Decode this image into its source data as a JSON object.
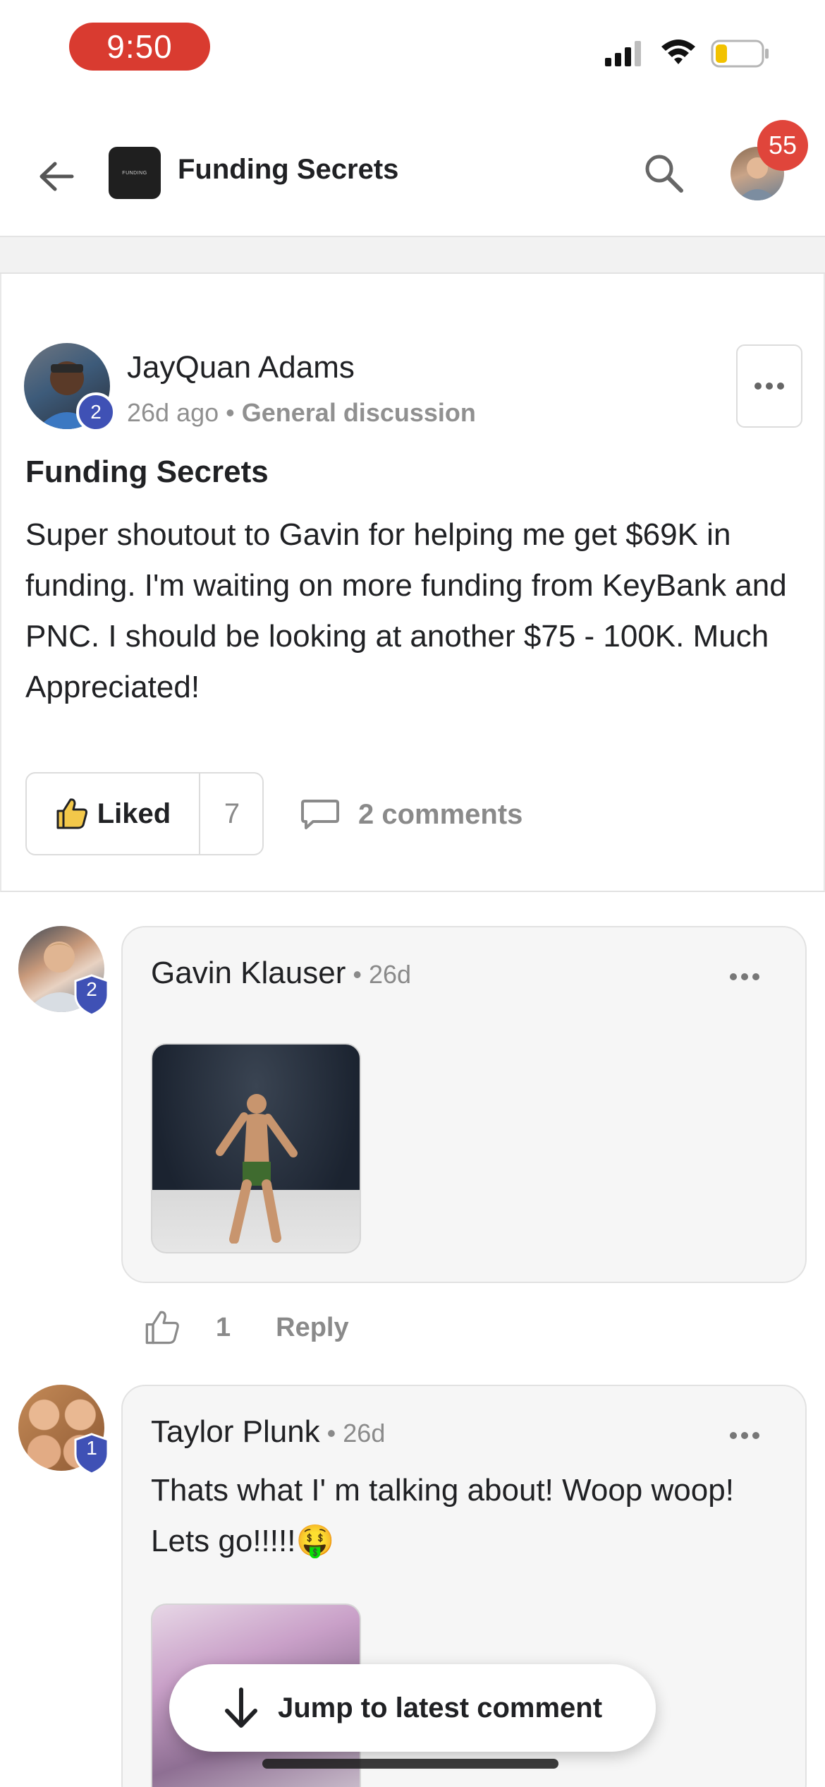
{
  "status_bar": {
    "time": "9:50"
  },
  "header": {
    "group_name": "Funding Secrets",
    "logo_text": "FUNDING",
    "notification_count": "55"
  },
  "post": {
    "author": "JayQuan Adams",
    "level": "2",
    "age": "26d ago",
    "meta_separator": " • ",
    "category": "General discussion",
    "title": "Funding Secrets",
    "body": "Super shoutout to Gavin for helping me get $69K in funding. I'm waiting on more funding from KeyBank and PNC. I should be looking at another $75 - 100K. Much Appreciated!",
    "like_label": "Liked",
    "like_count": "7",
    "comments_label": "2 comments"
  },
  "comments": [
    {
      "author": "Gavin Klauser",
      "age": " • 26d",
      "level": "2",
      "like_count": "1",
      "reply_label": "Reply"
    },
    {
      "author": "Taylor Plunk",
      "age": " • 26d",
      "level": "1",
      "text": "Thats what I' m talking about! Woop woop! Lets go!!!!!🤑"
    }
  ],
  "jump_button": {
    "label": "Jump to latest comment"
  },
  "colors": {
    "time_pill": "#d93b30",
    "notification_badge": "#e0453b",
    "level_badge": "#3f51b5",
    "muted_text": "#8a8a8a",
    "bubble_bg": "#f6f6f6"
  },
  "icons": {
    "back": "arrow-left-icon",
    "search": "search-icon",
    "more": "ellipsis-icon",
    "like": "thumbs-up-icon",
    "comment": "comment-icon",
    "jump": "arrow-down-icon"
  }
}
